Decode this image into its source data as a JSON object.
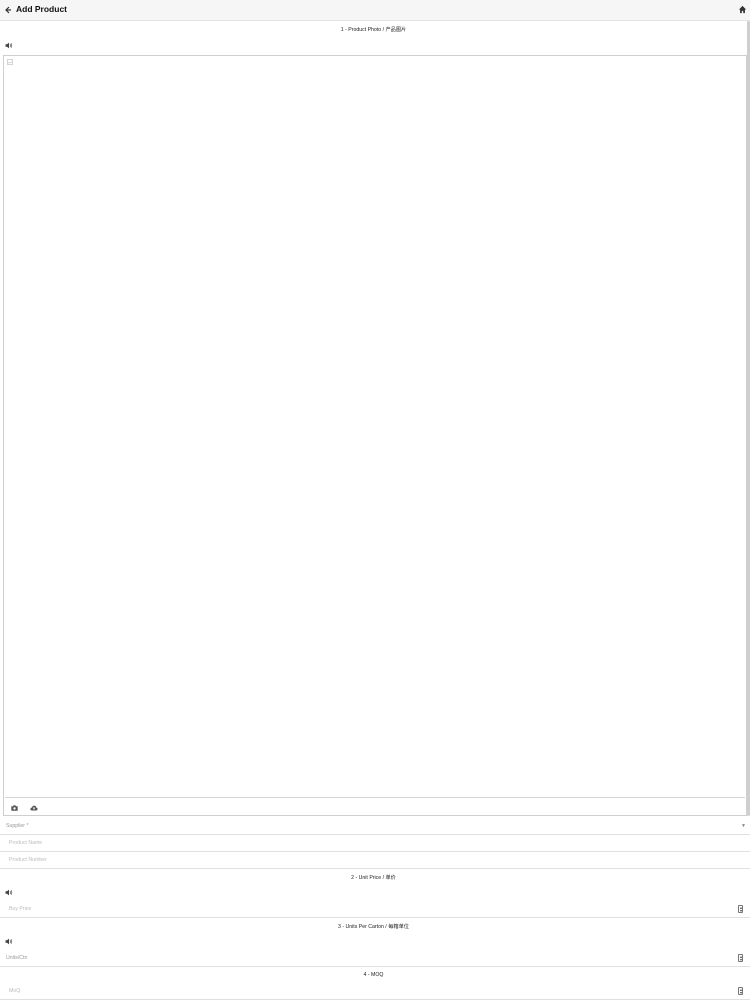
{
  "header": {
    "title": "Add Product",
    "back_icon": "back-arrow-icon",
    "home_icon": "home-icon"
  },
  "sections": {
    "photo": "1 - Product Photo / 产品图片",
    "unit_price": "2 - Unit Price / 单价",
    "units_per_carton": "3 - Units Per Carton / 每箱单位",
    "moq": "4 - MOQ"
  },
  "form": {
    "supplier_label": "Supplier *",
    "product_name_placeholder": "Product Name",
    "product_number_placeholder": "Product Number",
    "buy_price_placeholder": "Buy Price",
    "units_ctn_label": "Units/Ctn",
    "moq_placeholder": "MoQ"
  },
  "icons": {
    "speaker": "speaker-icon",
    "camera": "camera-icon",
    "upload": "cloud-upload-icon",
    "broken_image": "broken-image-icon",
    "dropdown": "dropdown-caret-icon"
  }
}
